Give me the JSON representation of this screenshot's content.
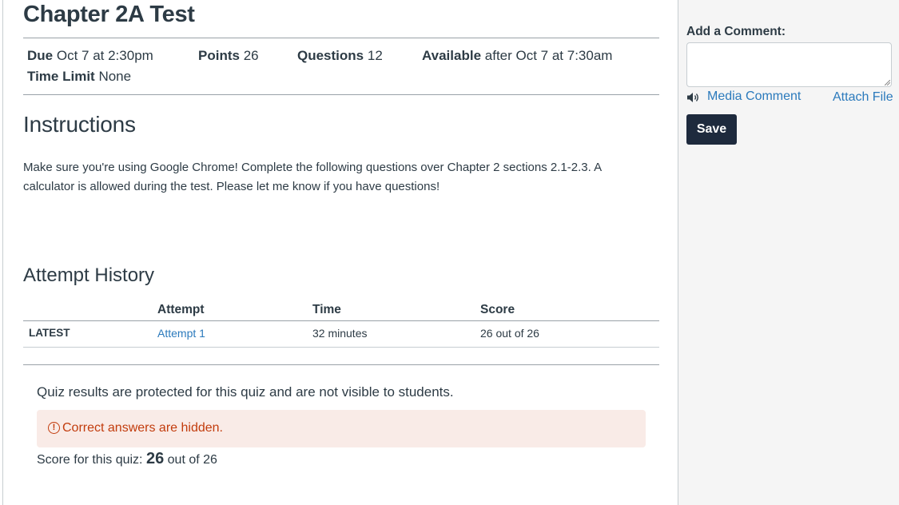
{
  "quiz": {
    "title": "Chapter 2A Test",
    "due_label": "Due",
    "due_value": "Oct 7 at 2:30pm",
    "points_label": "Points",
    "points_value": "26",
    "questions_label": "Questions",
    "questions_value": "12",
    "available_label": "Available",
    "available_value": "after Oct 7 at 7:30am",
    "time_limit_label": "Time Limit",
    "time_limit_value": "None"
  },
  "instructions": {
    "heading": "Instructions",
    "text": "Make sure you're using Google Chrome! Complete the following questions over Chapter 2 sections 2.1-2.3. A calculator is allowed during the test. Please let me know if you have questions!"
  },
  "attempt_history": {
    "heading": "Attempt History",
    "columns": [
      "Attempt",
      "Time",
      "Score"
    ],
    "rows": [
      {
        "label": "LATEST",
        "attempt": "Attempt 1",
        "time": "32 minutes",
        "score": "26 out of 26"
      }
    ]
  },
  "results": {
    "protected_text": "Quiz results are protected for this quiz and are not visible to students.",
    "alert_icon": "exclamation-circle-icon",
    "alert_text": "Correct answers are hidden.",
    "score_prefix": "Score for this quiz:",
    "score_value": "26",
    "score_suffix": "out of 26"
  },
  "sidebar": {
    "add_comment_label": "Add a Comment:",
    "comment_value": "",
    "media_icon": "speaker-icon",
    "media_comment_label": "Media Comment",
    "attach_file_label": "Attach File",
    "save_label": "Save"
  },
  "colors": {
    "text": "#2d3b45",
    "link": "#2b7abc",
    "alert_bg": "#f9ebe7",
    "alert_text": "#c23c0d",
    "save_button_bg": "#1e2a3d",
    "sidebar_bg": "#f5f5f5"
  }
}
